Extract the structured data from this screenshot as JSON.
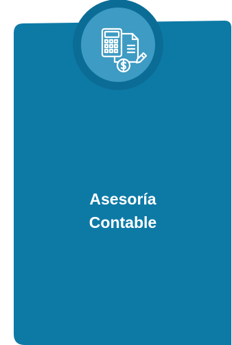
{
  "card": {
    "title_line_1": "Asesoría",
    "title_line_2": "Contable",
    "icon": "accounting-calculator-document-icon",
    "colors": {
      "card_background": "#0D7AA6",
      "badge_outer_ring": "#0B6D96",
      "badge_inner_circle": "#3E9BC3",
      "icon_stroke": "#FFFFFF",
      "text": "#FFFFFF"
    }
  }
}
